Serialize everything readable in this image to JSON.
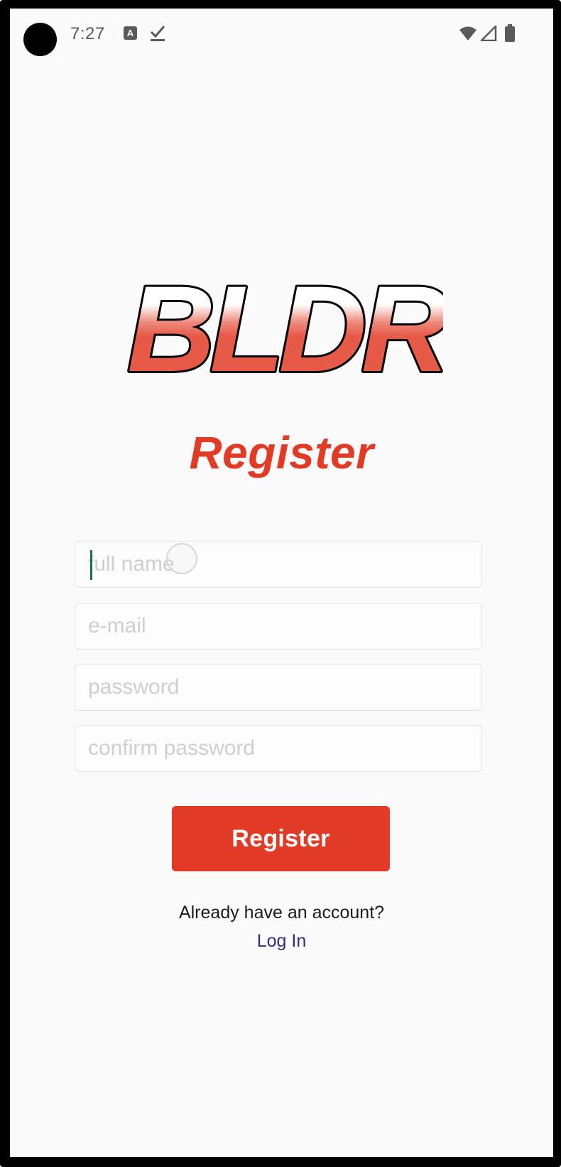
{
  "status_bar": {
    "time": "7:27",
    "icons": [
      "camera-cutout",
      "font-a-icon",
      "download-check-icon",
      "wifi-icon",
      "cellular-signal-icon",
      "battery-icon"
    ]
  },
  "logo": {
    "text": "BLDR",
    "colors": {
      "fill": "#e65a48",
      "outline": "#000000",
      "highlight": "#ffffff"
    }
  },
  "page": {
    "title": "Register"
  },
  "form": {
    "full_name_placeholder": "full name",
    "email_placeholder": "e-mail",
    "password_placeholder": "password",
    "confirm_password_placeholder": "confirm password",
    "submit_label": "Register"
  },
  "footer": {
    "prompt": "Already have an account?",
    "login_link": "Log In"
  },
  "colors": {
    "accent": "#e23a25",
    "link": "#2f2e86",
    "background": "#fbfbfb",
    "field_border": "#e2e2e2",
    "placeholder": "#cfcfcf"
  }
}
